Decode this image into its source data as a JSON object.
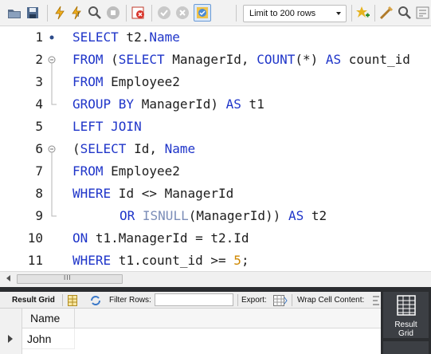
{
  "toolbar": {
    "limit_label": "Limit to 200 rows",
    "icons": [
      "open-file-icon",
      "save-icon",
      "execute-icon",
      "execute-current-icon",
      "explain-icon",
      "stop-icon",
      "toggle-error-icon",
      "commit-icon",
      "rollback-icon",
      "autocommit-icon",
      "add-snippet-icon",
      "beautify-icon",
      "find-icon",
      "invisible-chars-icon"
    ]
  },
  "editor": {
    "lines": [
      {
        "num": "1"
      },
      {
        "num": "2"
      },
      {
        "num": "3"
      },
      {
        "num": "4"
      },
      {
        "num": "5"
      },
      {
        "num": "6"
      },
      {
        "num": "7"
      },
      {
        "num": "8"
      },
      {
        "num": "9"
      },
      {
        "num": "10"
      },
      {
        "num": "11"
      }
    ],
    "tokens": {
      "l1": [
        "SELECT",
        " t2.",
        "Name"
      ],
      "l2": [
        "FROM",
        " (",
        "SELECT",
        " ManagerId, ",
        "COUNT",
        "(*) ",
        "AS",
        " count_id"
      ],
      "l3": [
        "FROM",
        " Employee2"
      ],
      "l4": [
        "GROUP BY",
        " ManagerId) ",
        "AS",
        " t1"
      ],
      "l5": [
        "LEFT JOIN"
      ],
      "l6": [
        "(",
        "SELECT",
        " Id, ",
        "Name"
      ],
      "l7": [
        "FROM",
        " Employee2"
      ],
      "l8": [
        "WHERE",
        " Id <> ManagerId"
      ],
      "l9": [
        "OR",
        " ",
        "ISNULL",
        "(ManagerId)) ",
        "AS",
        " t2"
      ],
      "l10": [
        "ON",
        " t1.ManagerId = t2.Id"
      ],
      "l11": [
        "WHERE",
        " t1.count_id >= ",
        "5",
        ";"
      ]
    }
  },
  "scrollbar": {
    "grip": "III"
  },
  "result_toolbar": {
    "result_grid_label": "Result Grid",
    "filter_label": "Filter Rows:",
    "filter_value": "",
    "export_label": "Export:",
    "wrap_label": "Wrap Cell Content:"
  },
  "grid": {
    "columns": [
      "Name"
    ],
    "rows": [
      [
        "John"
      ]
    ]
  },
  "side_panel": {
    "result_grid_line1": "Result",
    "result_grid_line2": "Grid"
  },
  "colors": {
    "keyword": "#1f35c9",
    "number": "#cf8800",
    "panel_dark": "#2b2d30"
  }
}
